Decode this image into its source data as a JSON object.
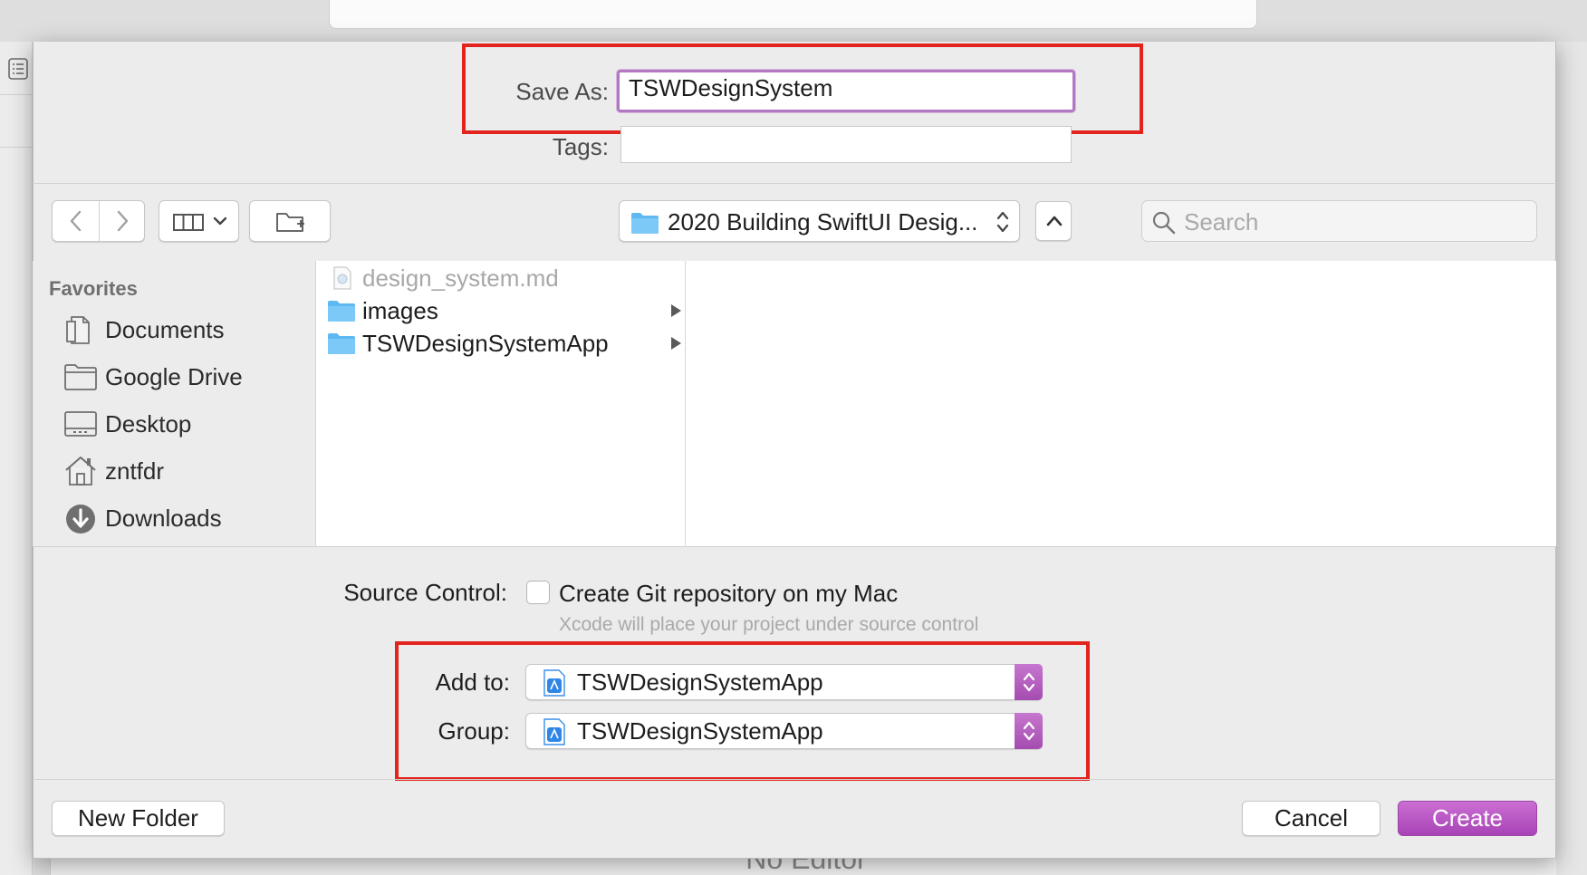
{
  "background": {
    "editor_placeholder": "No Editor"
  },
  "save_as": {
    "label": "Save As:",
    "value": "TSWDesignSystem"
  },
  "tags": {
    "label": "Tags:",
    "value": ""
  },
  "toolbar": {
    "back_icon": "chevron-left-icon",
    "forward_icon": "chevron-right-icon",
    "view_mode_icon": "column-view-icon",
    "new_folder_icon": "new-folder-icon",
    "location": "2020 Building SwiftUI Desig...",
    "search_placeholder": "Search"
  },
  "sidebar": {
    "heading": "Favorites",
    "items": [
      {
        "label": "Documents",
        "icon": "documents-icon"
      },
      {
        "label": "Google Drive",
        "icon": "folder-icon"
      },
      {
        "label": "Desktop",
        "icon": "desktop-icon"
      },
      {
        "label": "zntfdr",
        "icon": "home-icon"
      },
      {
        "label": "Downloads",
        "icon": "downloads-icon"
      }
    ]
  },
  "files": [
    {
      "name": "design_system.md",
      "dimmed": true,
      "is_folder": false
    },
    {
      "name": "images",
      "dimmed": false,
      "is_folder": true
    },
    {
      "name": "TSWDesignSystemApp",
      "dimmed": false,
      "is_folder": true
    }
  ],
  "source_control": {
    "label": "Source Control:",
    "checkbox_label": "Create Git repository on my Mac",
    "checked": false,
    "hint": "Xcode will place your project under source control"
  },
  "add_to": {
    "label": "Add to:",
    "value": "TSWDesignSystemApp"
  },
  "group": {
    "label": "Group:",
    "value": "TSWDesignSystemApp"
  },
  "buttons": {
    "new_folder": "New Folder",
    "cancel": "Cancel",
    "create": "Create"
  },
  "colors": {
    "accent": "#b45cc0",
    "highlight_box": "#e3231d",
    "folder": "#5fb8f2"
  }
}
